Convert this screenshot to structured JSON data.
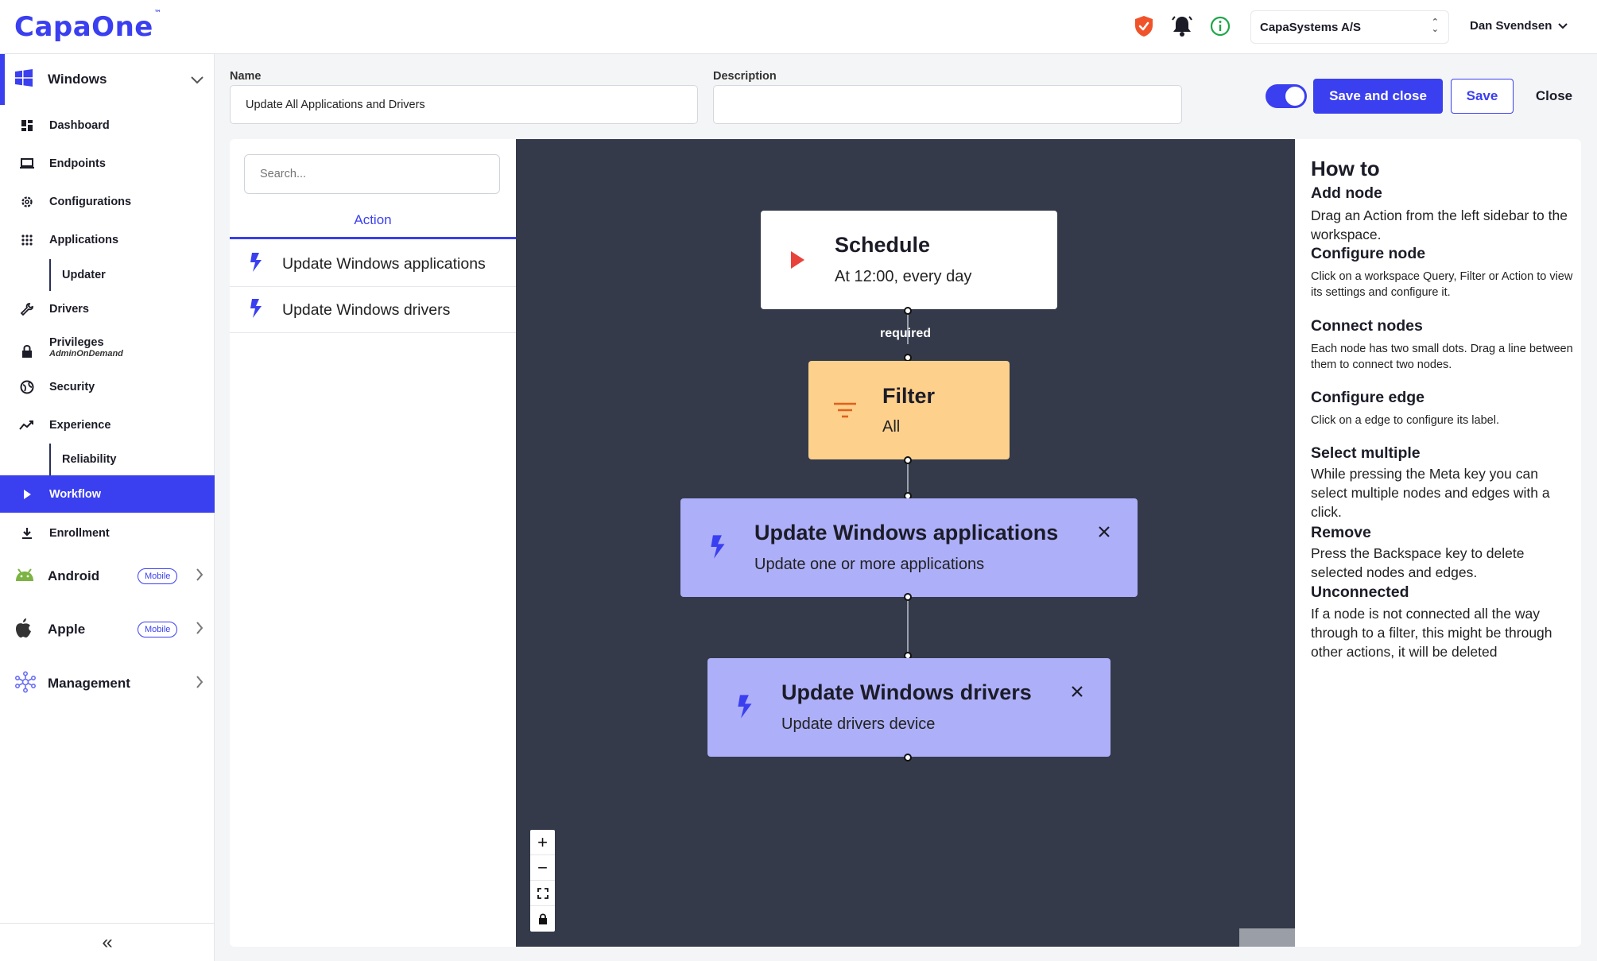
{
  "app": {
    "logo": "CapaOne",
    "logo_tm": "™"
  },
  "header": {
    "org": "CapaSystems A/S",
    "user": "Dan Svendsen"
  },
  "sidebar": {
    "windows": {
      "label": "Windows"
    },
    "items": [
      {
        "label": "Dashboard"
      },
      {
        "label": "Endpoints"
      },
      {
        "label": "Configurations"
      },
      {
        "label": "Applications"
      },
      {
        "label": "Updater"
      },
      {
        "label": "Drivers"
      },
      {
        "label": "Privileges",
        "sub": "AdminOnDemand"
      },
      {
        "label": "Security"
      },
      {
        "label": "Experience"
      },
      {
        "label": "Reliability"
      },
      {
        "label": "Workflow"
      },
      {
        "label": "Enrollment"
      }
    ],
    "android": {
      "label": "Android",
      "badge": "Mobile"
    },
    "apple": {
      "label": "Apple",
      "badge": "Mobile"
    },
    "management": {
      "label": "Management"
    },
    "collapse": "«"
  },
  "form": {
    "name_label": "Name",
    "name_value": "Update All Applications and Drivers",
    "description_label": "Description",
    "description_value": "",
    "toggle_on": true,
    "save_close": "Save and close",
    "save": "Save",
    "close": "Close"
  },
  "actions_panel": {
    "search_placeholder": "Search...",
    "tab": "Action",
    "items": [
      {
        "label": "Update Windows applications"
      },
      {
        "label": "Update Windows drivers"
      }
    ]
  },
  "canvas": {
    "nodes": [
      {
        "title": "Schedule",
        "subtitle": "At 12:00, every day",
        "icon": "play-icon",
        "color": "#ffffff"
      },
      {
        "title": "Filter",
        "subtitle": "All",
        "icon": "filter-icon",
        "color": "#fdd08c"
      },
      {
        "title": "Update Windows applications",
        "subtitle": "Update one or more applications",
        "icon": "bolt-icon",
        "color": "#adaff9"
      },
      {
        "title": "Update Windows drivers",
        "subtitle": "Update drivers device",
        "icon": "bolt-icon",
        "color": "#adaff9"
      }
    ],
    "edge_label": "required",
    "zoom_controls": [
      "+",
      "−"
    ]
  },
  "help": {
    "title": "How to",
    "sections": [
      {
        "heading": "Add node",
        "text": "Drag an Action from the left sidebar to the workspace."
      },
      {
        "heading": "Configure node",
        "text": "Click on a workspace Query, Filter or Action to view its settings and configure it."
      },
      {
        "heading": "Connect nodes",
        "text": "Each node has two small dots. Drag a line between them to connect two nodes."
      },
      {
        "heading": "Configure edge",
        "text": "Click on a edge to configure its label."
      },
      {
        "heading": "Select multiple",
        "text": "While pressing the Meta key you can select multiple nodes and edges with a click."
      },
      {
        "heading": "Remove",
        "text": "Press the Backspace key to delete selected nodes and edges."
      },
      {
        "heading": "Unconnected",
        "text": "If a node is not connected all the way through to a filter, this might be through other actions, it will be deleted"
      }
    ]
  },
  "colors": {
    "accent": "#3a3ff0",
    "canvas": "#343a4a",
    "filter_node": "#fdd08c",
    "action_node": "#adaff9",
    "schedule_play": "#e8423b"
  }
}
